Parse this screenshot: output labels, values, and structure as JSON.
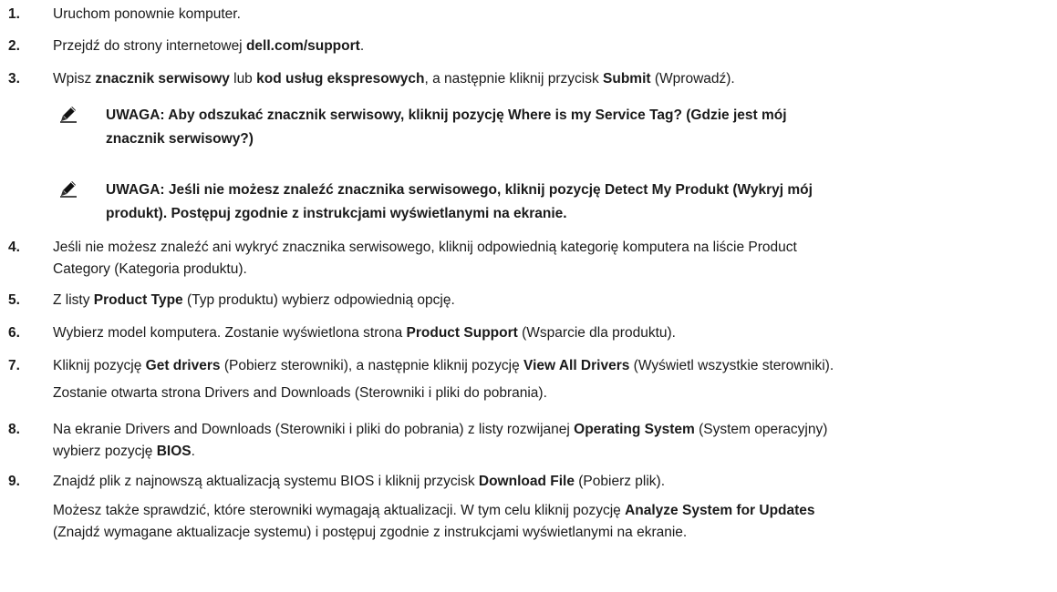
{
  "steps": [
    {
      "num": "1.",
      "parts": [
        [
          "Uruchom ponownie komputer.",
          0
        ]
      ]
    },
    {
      "num": "2.",
      "parts": [
        [
          "Przejdź do strony internetowej ",
          0
        ],
        [
          "dell.com/support",
          1
        ],
        [
          ".",
          0
        ]
      ]
    },
    {
      "num": "3.",
      "parts": [
        [
          "Wpisz ",
          0
        ],
        [
          "znacznik serwisowy",
          1
        ],
        [
          " lub ",
          0
        ],
        [
          "kod usług ekspresowych",
          1
        ],
        [
          ", a następnie kliknij przycisk ",
          0
        ],
        [
          "Submit",
          1
        ],
        [
          " (Wprowadź).",
          0
        ]
      ]
    },
    {
      "num": "4.",
      "line1": "Jeśli nie możesz znaleźć ani wykryć znacznika serwisowego, kliknij odpowiednią kategorię komputera na liście Product",
      "line2": "Category (Kategoria produktu)."
    },
    {
      "num": "5.",
      "parts": [
        [
          "Z listy ",
          0
        ],
        [
          "Product Type",
          1
        ],
        [
          " (Typ produktu) wybierz odpowiednią opcję.",
          0
        ]
      ]
    },
    {
      "num": "6.",
      "parts": [
        [
          "Wybierz model komputera. Zostanie wyświetlona strona ",
          0
        ],
        [
          "Product Support",
          1
        ],
        [
          " (Wsparcie dla produktu).",
          0
        ]
      ]
    },
    {
      "num": "7.",
      "parts": [
        [
          "Kliknij pozycję ",
          0
        ],
        [
          "Get drivers",
          1
        ],
        [
          " (Pobierz sterowniki), a następnie kliknij pozycję ",
          0
        ],
        [
          "View All Drivers",
          1
        ],
        [
          " (Wyświetl wszystkie sterowniki).",
          0
        ]
      ],
      "sub": "Zostanie otwarta strona Drivers and Downloads (Sterowniki i pliki do pobrania)."
    },
    {
      "num": "8.",
      "parts": [
        [
          "Na ekranie Drivers and Downloads (Sterowniki i pliki do pobrania) z listy rozwijanej ",
          0
        ],
        [
          "Operating System",
          1
        ],
        [
          " (System operacyjny)",
          0
        ]
      ],
      "parts2": [
        [
          "wybierz pozycję ",
          0
        ],
        [
          "BIOS",
          1
        ],
        [
          ".",
          0
        ]
      ]
    },
    {
      "num": "9.",
      "parts": [
        [
          "Znajdź plik z najnowszą aktualizacją systemu BIOS i kliknij przycisk ",
          0
        ],
        [
          "Download File",
          1
        ],
        [
          " (Pobierz plik).",
          0
        ]
      ],
      "sub_parts": [
        [
          "Możesz także sprawdzić, które sterowniki wymagają aktualizacji. W tym celu kliknij pozycję ",
          0
        ],
        [
          "Analyze System for Updates",
          1
        ]
      ],
      "sub2": "(Znajdź wymagane aktualizacje systemu) i postępuj zgodnie z instrukcjami wyświetlanymi na ekranie."
    }
  ],
  "notes": [
    {
      "line1": "UWAGA: Aby odszukać znacznik serwisowy, kliknij pozycję Where is my Service Tag? (Gdzie jest mój",
      "line2": "znacznik serwisowy?)",
      "icon": "note-pencil-icon"
    },
    {
      "line1": "UWAGA: Jeśli nie możesz znaleźć znacznika serwisowego, kliknij pozycję Detect My Produkt (Wykryj mój",
      "line2": "produkt). Postępuj zgodnie z instrukcjami wyświetlanymi na ekranie.",
      "icon": "note-pencil-icon"
    }
  ]
}
